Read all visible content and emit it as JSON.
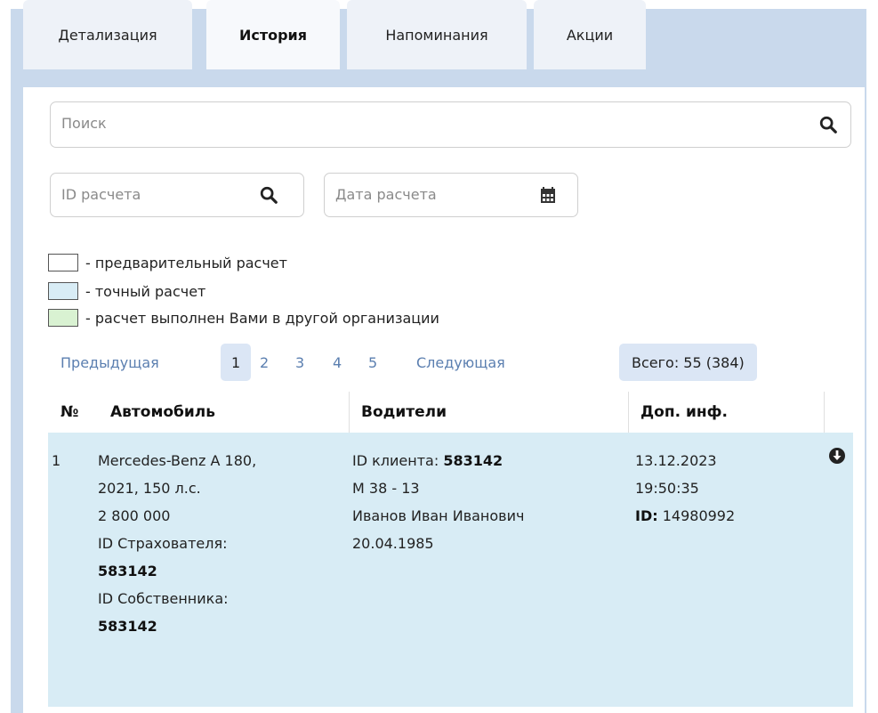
{
  "tabs": [
    "Детализация",
    "История",
    "Напоминания",
    "Акции"
  ],
  "search": {
    "placeholder": "Поиск"
  },
  "filters": {
    "id_placeholder": "ID расчета",
    "date_placeholder": "Дата расчета"
  },
  "legend": [
    {
      "text": "- предварительный расчет",
      "color": "#ffffff"
    },
    {
      "text": "- точный расчет",
      "color": "#d8ecf5"
    },
    {
      "text": "- расчет выполнен Вами в другой организации",
      "color": "#d9f2d2"
    }
  ],
  "pagination": {
    "prev": "Предыдущая",
    "pages": [
      "1",
      "2",
      "3",
      "4",
      "5"
    ],
    "current": "1",
    "next": "Следующая",
    "total": "Всего: 55 (384)"
  },
  "table": {
    "headers": [
      "№",
      "Автомобиль",
      "Водители",
      "Доп. инф."
    ],
    "row": {
      "num": "1",
      "car_lines": [
        "Mercedes-Benz A 180,",
        "2021, 150 л.с.",
        "2 800 000"
      ],
      "insurer_label": "ID Страхователя:",
      "insurer_id": "583142",
      "owner_label": "ID Собственника:",
      "owner_id": "583142",
      "client_label": "ID клиента: ",
      "client_id": "583142",
      "driver_lines": [
        "М 38 - 13",
        "Иванов Иван Иванович",
        "20.04.1985"
      ],
      "date": "13.12.2023",
      "time": "19:50:35",
      "id_label": "ID:",
      "id_value": " 14980992"
    }
  },
  "colors": {
    "accent": "#5b7fb0",
    "header_bg": "#c9d9ec",
    "row_bg": "#d8ecf5"
  }
}
